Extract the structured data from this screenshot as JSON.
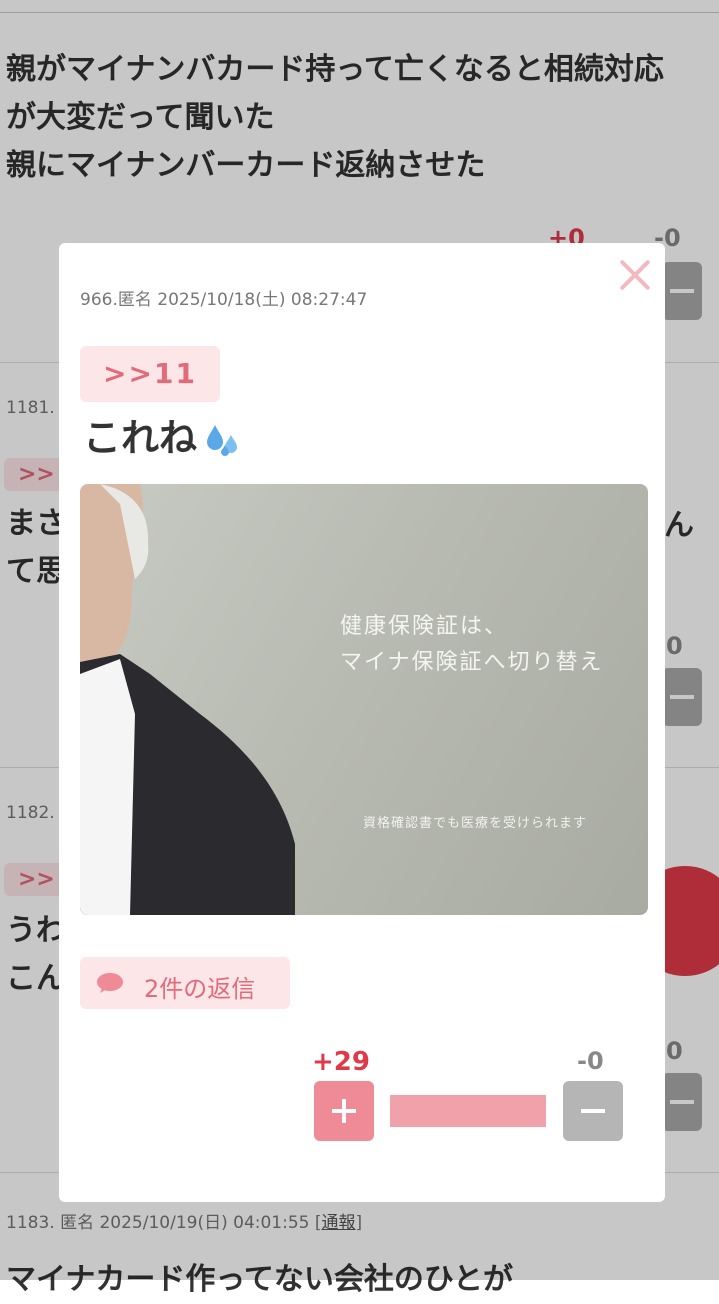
{
  "background_thread": {
    "post_top": {
      "body_lines": [
        "親がマイナンバカード持って亡くなると相続対応",
        "が大変だって聞いた",
        "親にマイナンバーカード返納させた"
      ],
      "vote_plus": "+0",
      "vote_minus": "-0"
    },
    "post_1181": {
      "meta_prefix": "1181.",
      "anchor": ">>",
      "body_line1_start": "まさ",
      "body_line1_end": "ん",
      "body_line2_start": "て思",
      "vote_minus": "0"
    },
    "post_1182": {
      "meta_prefix": "1182.",
      "anchor": ">>",
      "body_line1_start": "うわ",
      "body_line2_start": "こん",
      "vote_minus": "0"
    },
    "post_1183": {
      "meta": "1183. 匿名 2025/10/19(日) 04:01:55",
      "report_label": "通報",
      "body_partial": "マイナカード作ってない会社のひとが"
    }
  },
  "modal": {
    "meta": "966.匿名 2025/10/18(土) 08:27:47",
    "anchor": ">>11",
    "text": "これね",
    "text_emoji": "sweat-droplets-icon",
    "image": {
      "line1": "健康保険証は、",
      "line2": "マイナ保険証へ切り替え",
      "line3": "資格確認書でも医療を受けられます"
    },
    "replies_label": "2件の返信",
    "vote_plus": "+29",
    "vote_minus": "-0",
    "vote_ratio": 1.0,
    "colors": {
      "accent": "#e03a48",
      "pink_light": "#fde6e8",
      "pink_text": "#e26b7a"
    }
  }
}
